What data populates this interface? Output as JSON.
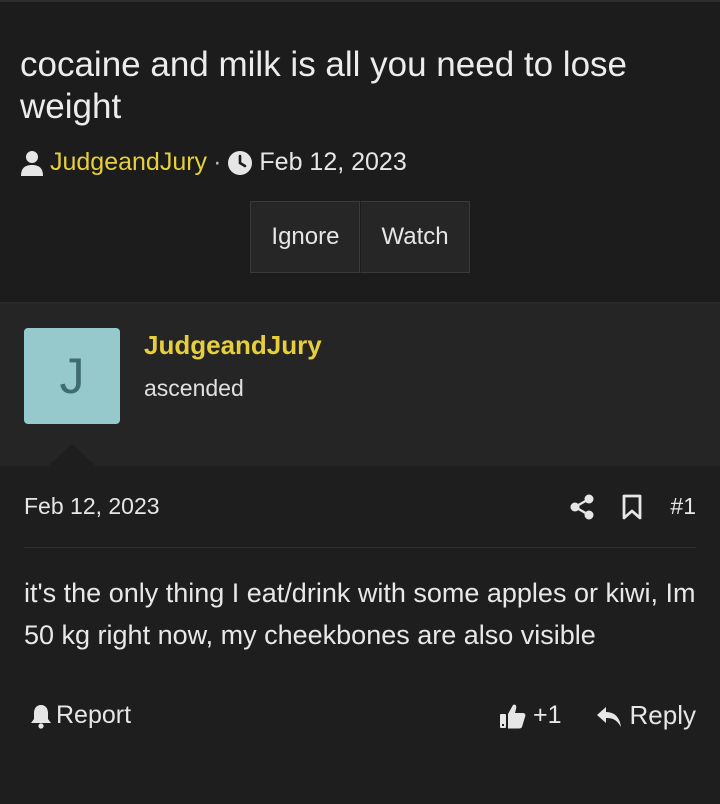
{
  "thread": {
    "title": "cocaine and milk is all you need to lose weight",
    "author": "JudgeandJury",
    "separator": "·",
    "date": "Feb 12, 2023",
    "buttons": {
      "ignore": "Ignore",
      "watch": "Watch"
    }
  },
  "post": {
    "avatar_letter": "J",
    "avatar_color": "#95c9cc",
    "username": "JudgeandJury",
    "user_title": "ascended",
    "date": "Feb 12, 2023",
    "number": "#1",
    "message": "it's the only thing I eat/drink with some apples or kiwi, Im 50 kg right now, my cheekbones are also visible",
    "footer": {
      "report_label": "Report",
      "reaction_count": "+1",
      "reply_label": "Reply"
    }
  },
  "colors": {
    "username": "#e7cf3b",
    "background": "#1c1c1c"
  },
  "icons": [
    "user-icon",
    "clock-icon",
    "share-icon",
    "bookmark-icon",
    "bell-icon",
    "thumbs-up-icon",
    "reply-icon"
  ]
}
